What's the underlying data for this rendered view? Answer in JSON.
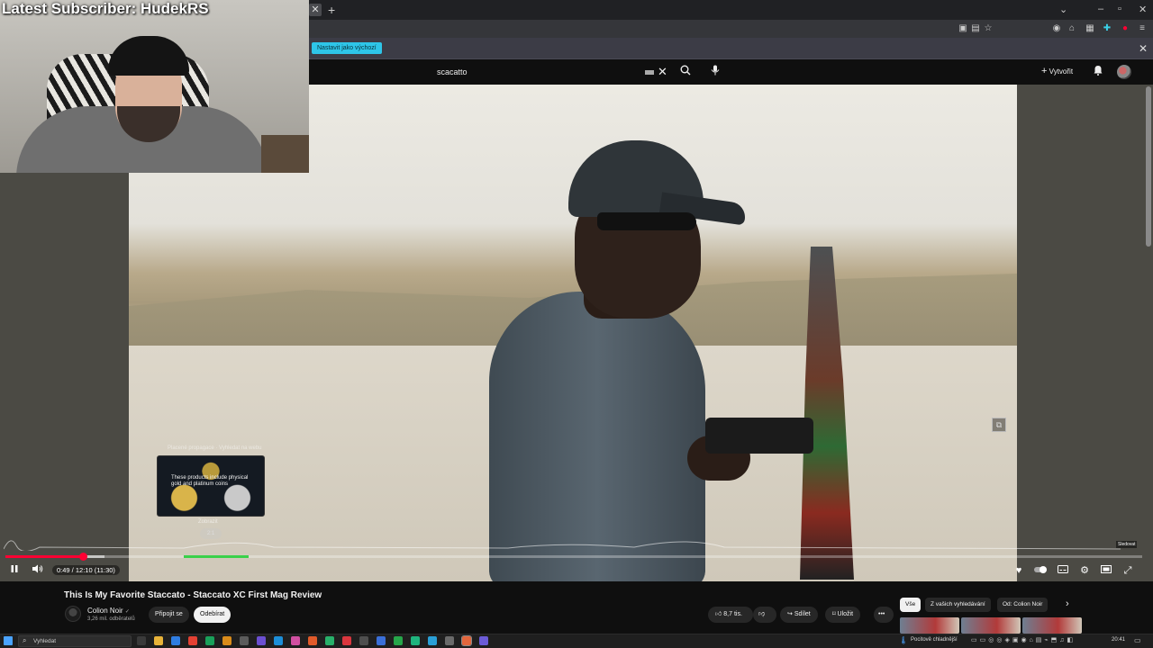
{
  "overlay": {
    "latest_subscriber": "Latest Subscriber: HudekRS"
  },
  "browser": {
    "info_button": "Nastavit jako výchozí",
    "tab_close_icon": "close-icon",
    "new_tab_icon": "plus-icon"
  },
  "youtube_header": {
    "search_value": "scacatto",
    "create_label": "Vytvořit"
  },
  "card": {
    "caption": "Placené propagace · Vyhledat na webu",
    "thumb_text": "These products include physical gold and platinum coins",
    "label": "Zobrazit",
    "duration": "2:1"
  },
  "player": {
    "time": "0:49 / 12:10 (11:30)",
    "badge": "Sledovat",
    "progress_fraction": 0.067
  },
  "video": {
    "title": "This Is My Favorite Staccato - Staccato XC First Mag Review",
    "channel_name": "Colion Noir",
    "channel_subs": "3,26 mil. odběratelů",
    "join_label": "Připojit se",
    "subscribe_label": "Odebírat",
    "likes": "8,7 tis.",
    "share_label": "Sdílet",
    "save_label": "Uložit"
  },
  "chips": {
    "all": "Vše",
    "from_searches": "Z vašich vyhledávání",
    "from_channel": "Od: Colion Noir"
  },
  "taskbar": {
    "search_placeholder": "Vyhledat",
    "weather": "Pocitově chladnější",
    "clock": "20:41"
  },
  "colors": {
    "accent_red": "#ff0033",
    "info_button": "#2ec5e8",
    "heatmap_green": "#3ad14a"
  }
}
